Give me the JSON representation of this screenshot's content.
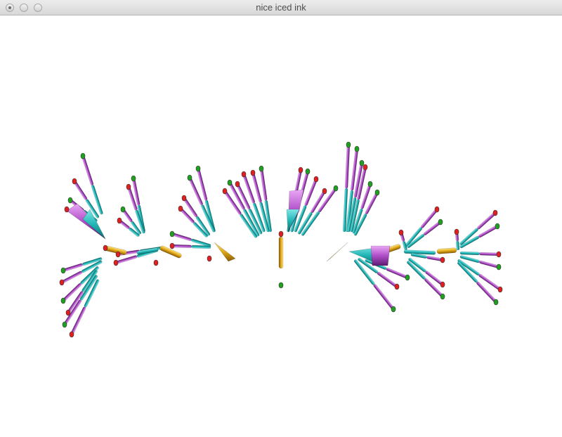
{
  "window": {
    "title": "nice iced ink",
    "buttons": [
      "close",
      "minimize",
      "zoom"
    ]
  },
  "scene": {
    "background": "#ffffff",
    "colors": {
      "teal": "#22b7b7",
      "magenta": "#b04fc8",
      "gold": "#e0b020",
      "tip_red": "#e02020",
      "tip_green": "#20a020"
    }
  }
}
